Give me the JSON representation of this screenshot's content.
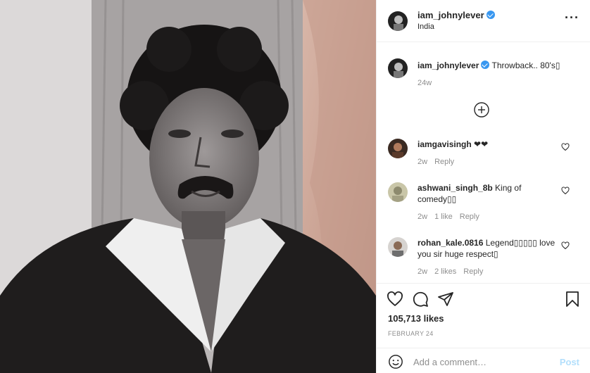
{
  "post": {
    "username": "iam_johnylever",
    "location": "India",
    "caption": "Throwback.. 80's▯",
    "caption_age": "24w",
    "likes": "105,713 likes",
    "date": "FEBRUARY 24"
  },
  "comments": [
    {
      "user": "iamgavisingh",
      "text": "❤❤",
      "age": "2w",
      "likes": "",
      "reply": "Reply"
    },
    {
      "user": "ashwani_singh_8b",
      "text": "King of comedy▯▯",
      "age": "2w",
      "likes": "1 like",
      "reply": "Reply"
    },
    {
      "user": "rohan_kale.0816",
      "text": "Legend▯▯▯▯▯ love you sir huge respect▯",
      "age": "2w",
      "likes": "2 likes",
      "reply": "Reply"
    }
  ],
  "add_comment": {
    "placeholder": "Add a comment…",
    "post_label": "Post"
  },
  "icons": {
    "more": "more-options-icon",
    "verified": "verified-badge-icon",
    "load_more": "plus-circle-icon",
    "like": "heart-icon",
    "comment": "comment-bubble-icon",
    "share": "paper-plane-icon",
    "save": "bookmark-icon",
    "emoji": "smiley-icon"
  },
  "colors": {
    "verified": "#3897f0",
    "post_button": "#b2dffc",
    "muted": "#8e8e8e"
  }
}
